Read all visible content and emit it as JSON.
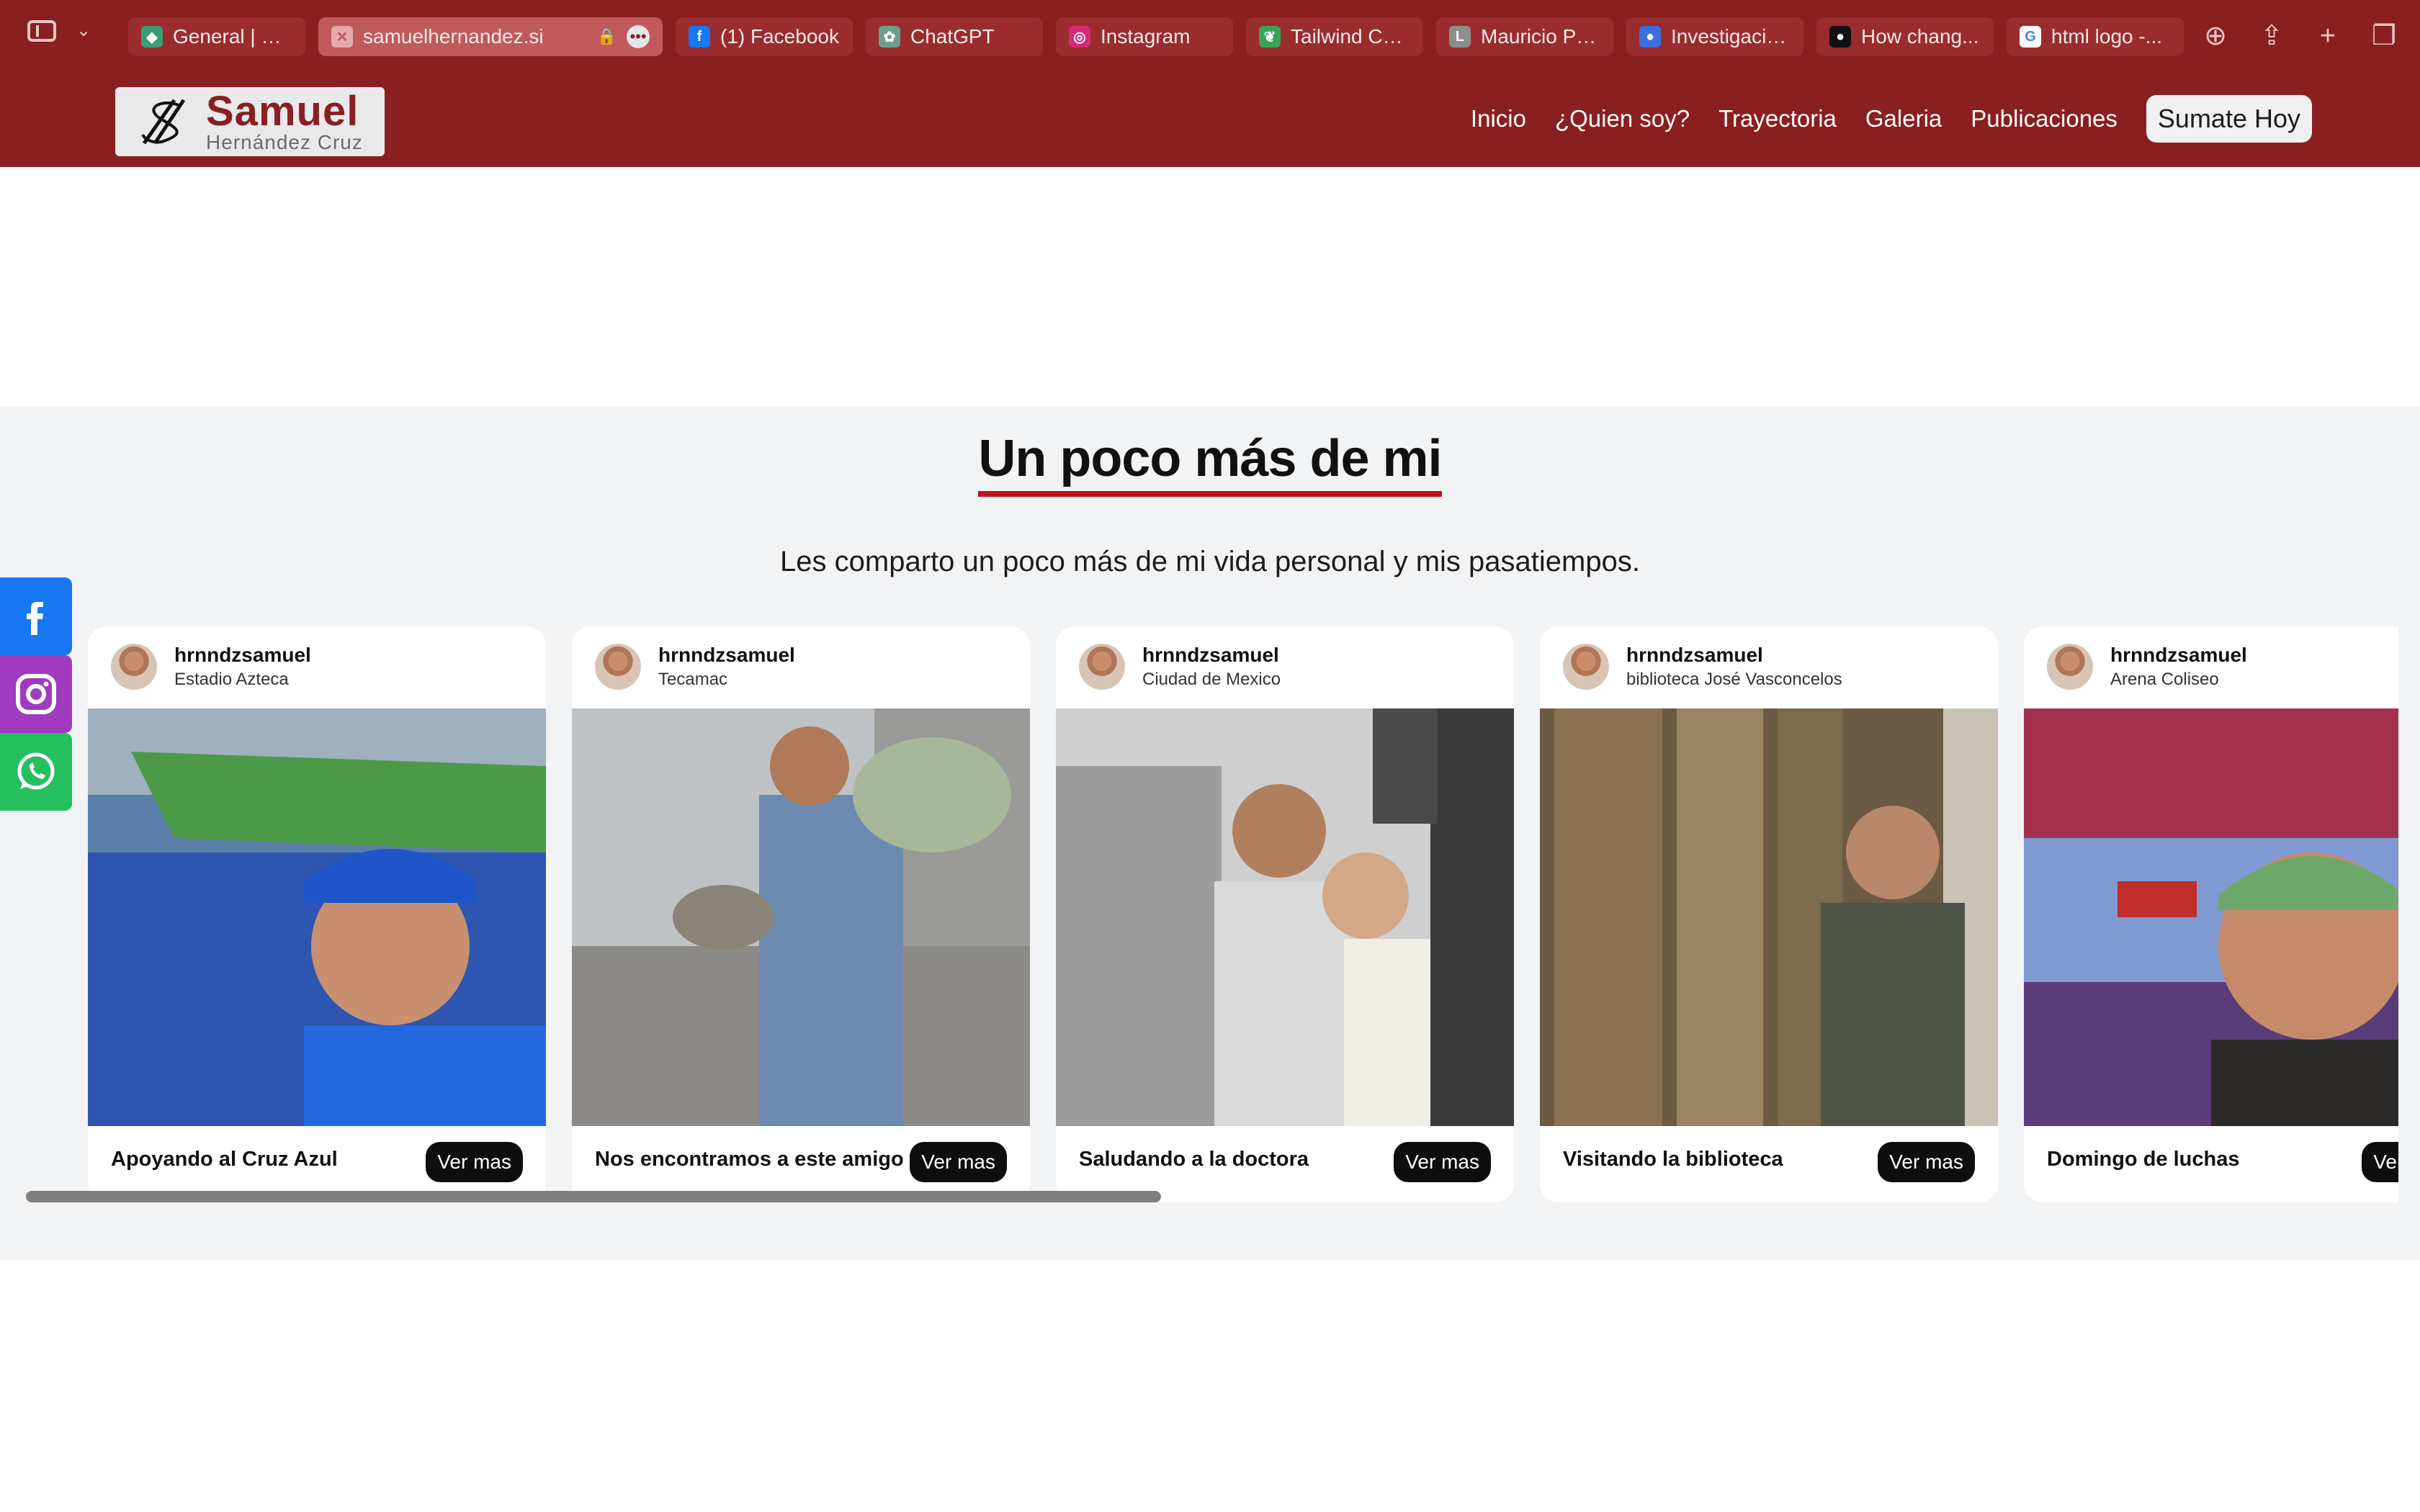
{
  "browser": {
    "tabs": [
      {
        "title": "General | Sit...",
        "icon": "diamond-icon",
        "color": "#3c9c78"
      },
      {
        "title": "samuelhernandez.si",
        "icon": "close-icon",
        "color": "#c05a5c"
      },
      {
        "title": "(1) Facebook",
        "icon": "facebook-icon",
        "color": "#1877f2"
      },
      {
        "title": "ChatGPT",
        "icon": "openai-icon",
        "color": "#6e9e8c"
      },
      {
        "title": "Instagram",
        "icon": "instagram-icon",
        "color": "#d62976"
      },
      {
        "title": "Tailwind CS...",
        "icon": "leaf-icon",
        "color": "#3aa55a"
      },
      {
        "title": "Mauricio Po...",
        "icon": "letter-l-icon",
        "color": "#8d8d8d"
      },
      {
        "title": "Investigacio...",
        "icon": "circle-icon",
        "color": "#3b6fe0"
      },
      {
        "title": "How chang...",
        "icon": "github-icon",
        "color": "#111111"
      },
      {
        "title": "html logo -...",
        "icon": "google-icon",
        "color": "#ffffff"
      }
    ]
  },
  "header": {
    "logo_name": "Samuel",
    "logo_sub": "Hernández Cruz",
    "nav": [
      "Inicio",
      "¿Quien soy?",
      "Trayectoria",
      "Galeria",
      "Publicaciones"
    ],
    "cta": "Sumate Hoy"
  },
  "about": {
    "title": "Un poco más de mi",
    "subtitle": "Les comparto un poco más de mi vida personal y mis pasatiempos.",
    "cards": [
      {
        "user": "hrnndzsamuel",
        "location": "Estadio Azteca",
        "caption": "Apoyando al Cruz Azul",
        "button": "Ver mas"
      },
      {
        "user": "hrnndzsamuel",
        "location": "Tecamac",
        "caption": "Nos encontramos a este amigo",
        "button": "Ver mas"
      },
      {
        "user": "hrnndzsamuel",
        "location": "Ciudad de Mexico",
        "caption": "Saludando a la doctora",
        "button": "Ver mas"
      },
      {
        "user": "hrnndzsamuel",
        "location": "biblioteca José Vasconcelos",
        "caption": "Visitando la biblioteca",
        "button": "Ver mas"
      },
      {
        "user": "hrnndzsamuel",
        "location": "Arena Coliseo",
        "caption": "Domingo de luchas",
        "button": "Ver mas"
      }
    ]
  },
  "colors": {
    "brand": "#8a1f22",
    "accent_underline": "#c1121f",
    "facebook": "#1877f2",
    "instagram": "#a03bc0",
    "whatsapp": "#25c05e"
  }
}
